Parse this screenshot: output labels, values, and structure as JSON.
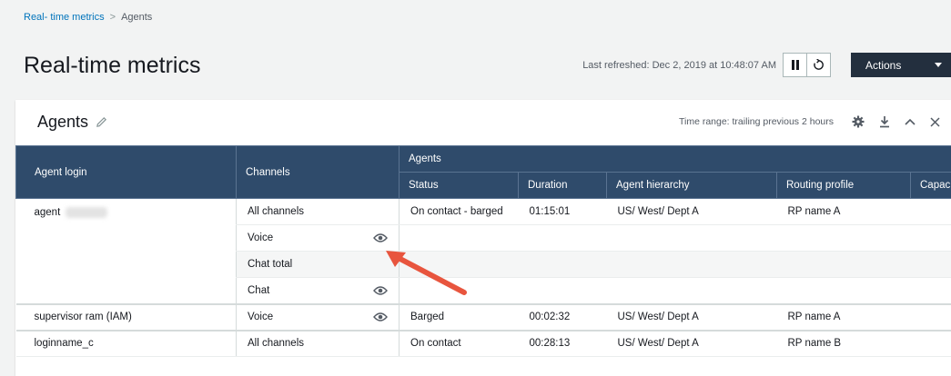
{
  "breadcrumb": {
    "parent": "Real- time metrics",
    "separator": ">",
    "current": "Agents"
  },
  "header": {
    "title": "Real-time metrics",
    "last_refreshed": "Last refreshed: Dec 2, 2019 at 10:48:07 AM",
    "actions_label": "Actions"
  },
  "panel": {
    "title": "Agents",
    "time_range": "Time range: trailing previous 2 hours"
  },
  "table": {
    "headers": {
      "agent_login": "Agent login",
      "channels": "Channels",
      "agents_group": "Agents",
      "status": "Status",
      "duration": "Duration",
      "agent_hierarchy": "Agent hierarchy",
      "routing_profile": "Routing profile",
      "capacity": "Capac"
    },
    "rows": [
      {
        "agent": "agent",
        "channel": "All channels",
        "eye": false,
        "status": "On contact - barged",
        "duration": "01:15:01",
        "hierarchy": "US/ West/ Dept A",
        "routing": "RP name A"
      },
      {
        "agent": "",
        "channel": "Voice",
        "eye": true,
        "status": "",
        "duration": "",
        "hierarchy": "",
        "routing": ""
      },
      {
        "agent": "",
        "channel": "Chat total",
        "eye": false,
        "status": "",
        "duration": "",
        "hierarchy": "",
        "routing": ""
      },
      {
        "agent": "",
        "channel": "Chat",
        "eye": true,
        "status": "",
        "duration": "",
        "hierarchy": "",
        "routing": ""
      },
      {
        "agent": "supervisor ram  (IAM)",
        "channel": "Voice",
        "eye": true,
        "status": "Barged",
        "duration": "00:02:32",
        "hierarchy": "US/ West/ Dept A",
        "routing": "RP name A"
      },
      {
        "agent": "loginname_c",
        "channel": "All channels",
        "eye": false,
        "status": "On contact",
        "duration": "00:28:13",
        "hierarchy": "US/ West/ Dept A",
        "routing": "RP name B"
      }
    ]
  },
  "colors": {
    "header_bg": "#2f4b6b",
    "arrow": "#e8553e",
    "link": "#0073bb",
    "actions_bg": "#232f3e"
  }
}
